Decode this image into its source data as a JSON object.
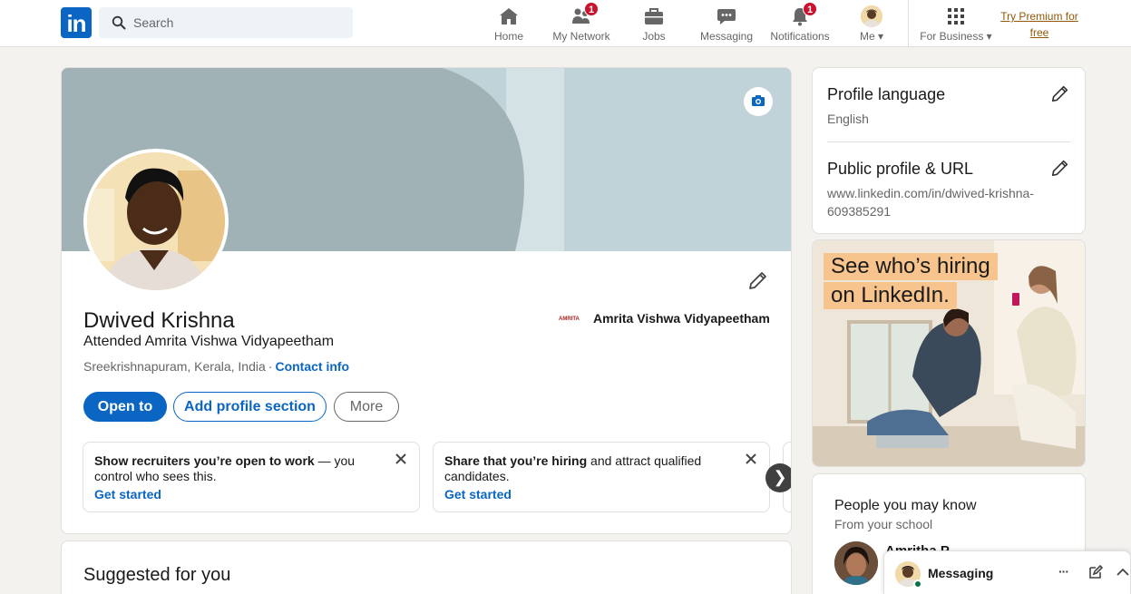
{
  "nav": {
    "logo_text": "in",
    "search_placeholder": "Search",
    "items": [
      {
        "label": "Home",
        "icon": "home-icon",
        "badge": ""
      },
      {
        "label": "My Network",
        "icon": "network-icon",
        "badge": "1"
      },
      {
        "label": "Jobs",
        "icon": "briefcase-icon",
        "badge": ""
      },
      {
        "label": "Messaging",
        "icon": "chat-icon",
        "badge": ""
      },
      {
        "label": "Notifications",
        "icon": "bell-icon",
        "badge": "1"
      },
      {
        "label": "Me",
        "icon": "avatar",
        "badge": ""
      }
    ],
    "business_label": "For Business",
    "premium_line1": "Try Premium for",
    "premium_line2": "free"
  },
  "profile": {
    "name": "Dwived Krishna",
    "headline": "Attended Amrita Vishwa Vidyapeetham",
    "location": "Sreekrishnapuram, Kerala, India",
    "separator": "·",
    "contact_info": "Contact info",
    "school": "Amrita Vishwa Vidyapeetham",
    "school_logo_text": "AMRITA",
    "buttons": {
      "open_to": "Open to",
      "add_section": "Add profile section",
      "more": "More"
    },
    "promos": [
      {
        "bold": "Show recruiters you’re open to work",
        "rest": " — you control who sees this.",
        "link": "Get started"
      },
      {
        "bold": "Share that you’re hiring",
        "rest": " and attract qualified candidates.",
        "link": "Get started"
      }
    ],
    "carousel_next": "❯"
  },
  "suggested": {
    "title": "Suggested for you"
  },
  "sidebar": {
    "profile_language_title": "Profile language",
    "profile_language_value": "English",
    "public_profile_title": "Public profile & URL",
    "public_profile_url_line1": "www.linkedin.com/in/dwived-krishna-",
    "public_profile_url_line2": "609385291"
  },
  "ad": {
    "line1": "See who’s hiring",
    "line2": "on LinkedIn."
  },
  "pymk": {
    "title": "People you may know",
    "subtitle": "From your school",
    "first_name": "Amritha P"
  },
  "messaging": {
    "title": "Messaging",
    "more": "···"
  },
  "colors": {
    "brand_blue": "#0a66c2",
    "badge_red": "#cb112d",
    "premium_gold": "#915907",
    "cover_dark": "#a0b2b6",
    "cover_light": "#bfd3d8"
  }
}
